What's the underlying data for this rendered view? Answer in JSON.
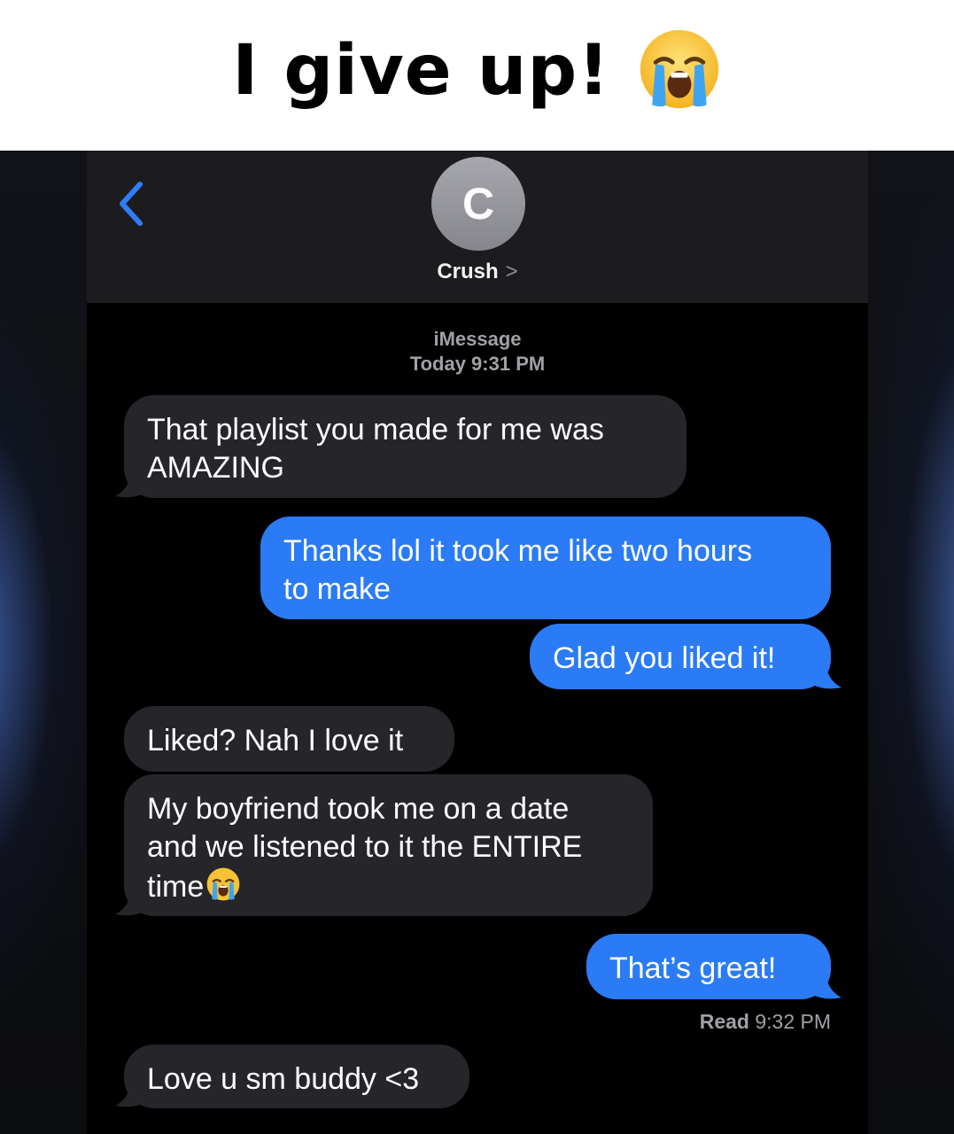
{
  "meme": {
    "caption": "I give up!",
    "caption_emoji": "loudly-crying-face"
  },
  "header": {
    "back_icon": "chevron-left-icon",
    "avatar_initial": "C",
    "contact_name": "Crush",
    "contact_chevron": ">"
  },
  "thread": {
    "service": "iMessage",
    "timestamp": "Today 9:31 PM",
    "messages": [
      {
        "from": "them",
        "text": "That playlist you made for me was\nAMAZING"
      },
      {
        "from": "me",
        "text": "Thanks lol it took me like two hours\nto make"
      },
      {
        "from": "me",
        "text": "Glad you liked it!"
      },
      {
        "from": "them",
        "text": "Liked? Nah I love it"
      },
      {
        "from": "them",
        "text": "My boyfriend took me on a date\nand we listened to it the ENTIRE\ntime",
        "emoji": "loudly-crying-face"
      },
      {
        "from": "me",
        "text": "That’s great!"
      },
      {
        "from": "them",
        "text": "Love u sm buddy <3"
      }
    ],
    "read_label": "Read",
    "read_time": "9:32 PM"
  },
  "colors": {
    "outgoing_bubble": "#2a7bf5",
    "incoming_bubble": "#26252a",
    "nav_bar": "#1c1c1e",
    "accent_blue": "#2f7cf6"
  }
}
